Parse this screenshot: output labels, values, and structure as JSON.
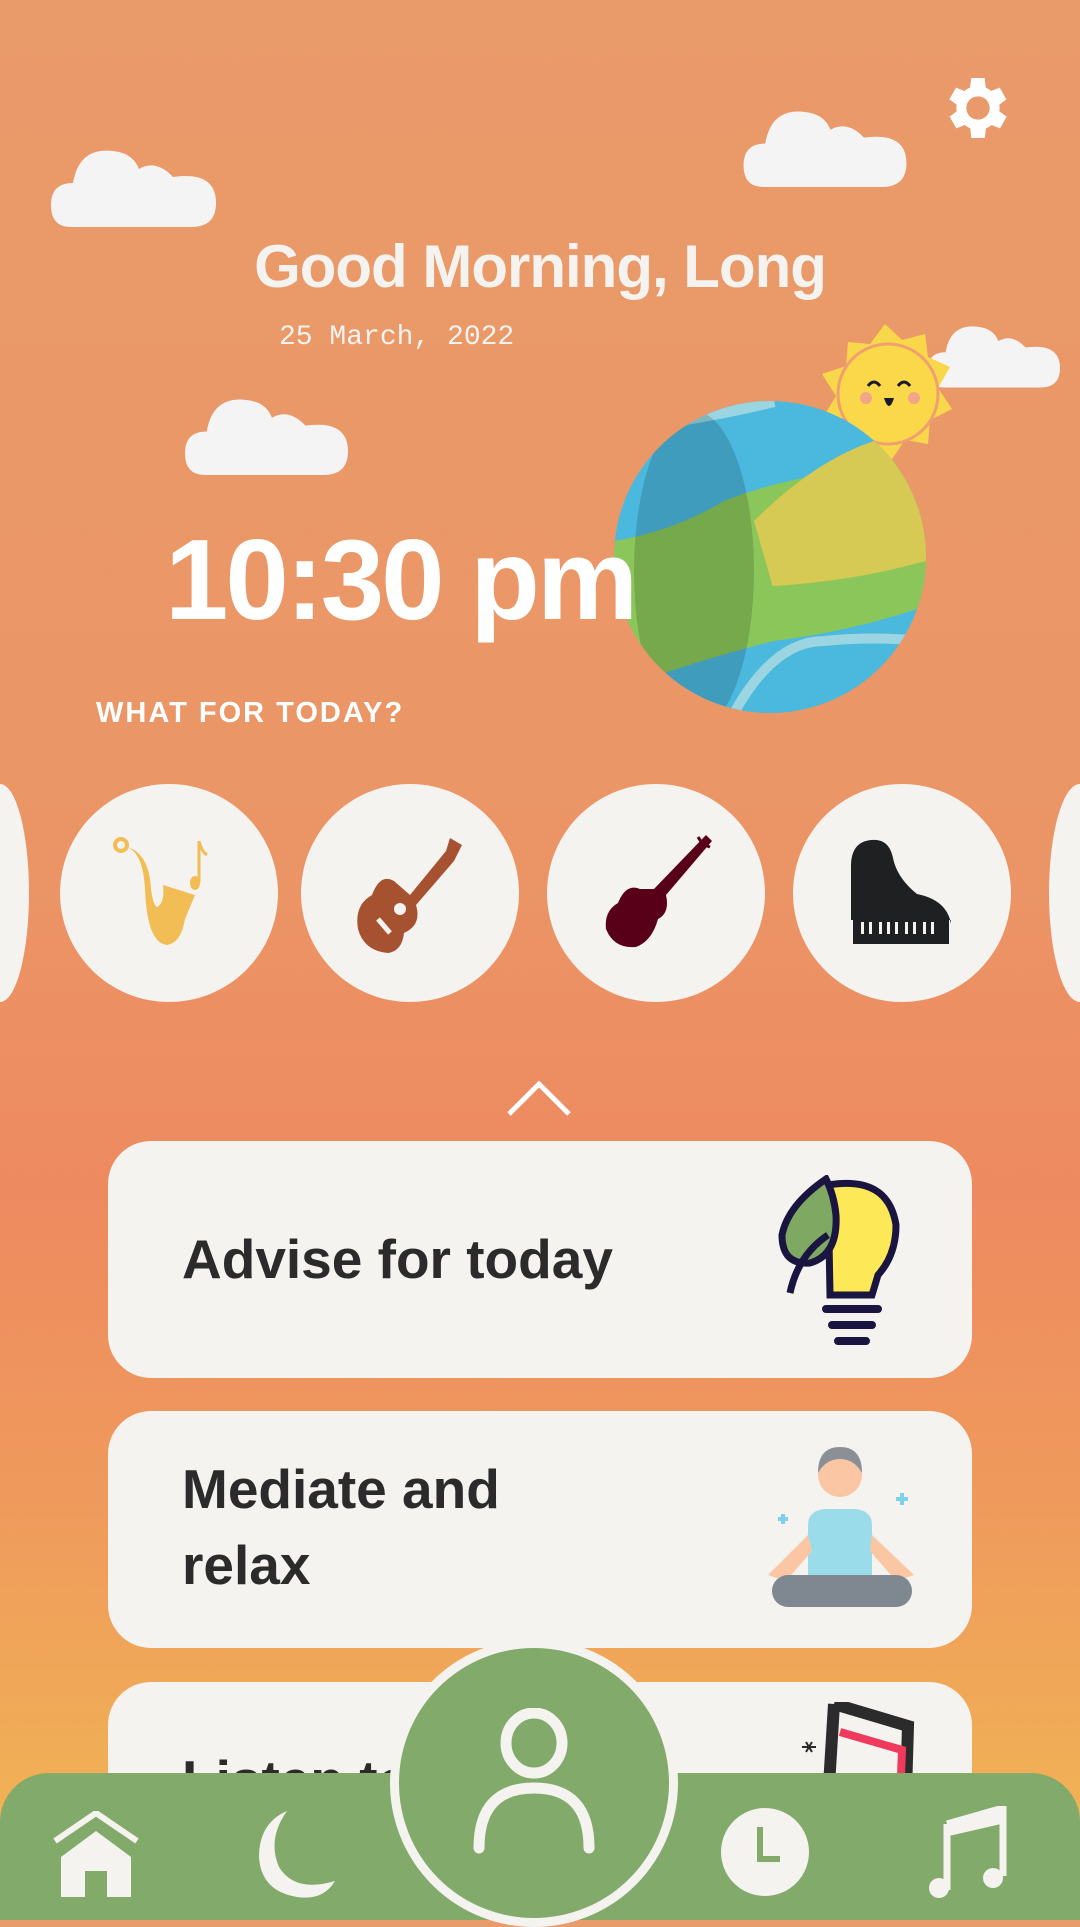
{
  "header": {
    "greeting": "Good Morning, Long",
    "date": "25 March, 2022",
    "time": "10:30 pm",
    "settings_icon": "gear-icon"
  },
  "section": {
    "title": "WHAT FOR TODAY?"
  },
  "instruments": [
    {
      "name": "saxophone",
      "icon": "saxophone-icon",
      "color": "#f2bd55"
    },
    {
      "name": "guitar",
      "icon": "guitar-icon",
      "color": "#a65231"
    },
    {
      "name": "violin",
      "icon": "violin-icon",
      "color": "#580018"
    },
    {
      "name": "piano",
      "icon": "piano-icon",
      "color": "#1f2021"
    }
  ],
  "cards": [
    {
      "label": "Advise for today",
      "icon": "lightbulb-leaf-icon"
    },
    {
      "label": "Mediate and relax",
      "icon": "meditation-person-icon"
    },
    {
      "label": "Listen to",
      "icon": "music-note-icon"
    }
  ],
  "nav": {
    "items": [
      "home",
      "sleep",
      "profile",
      "clock",
      "music"
    ],
    "color": "#82aa6a"
  }
}
